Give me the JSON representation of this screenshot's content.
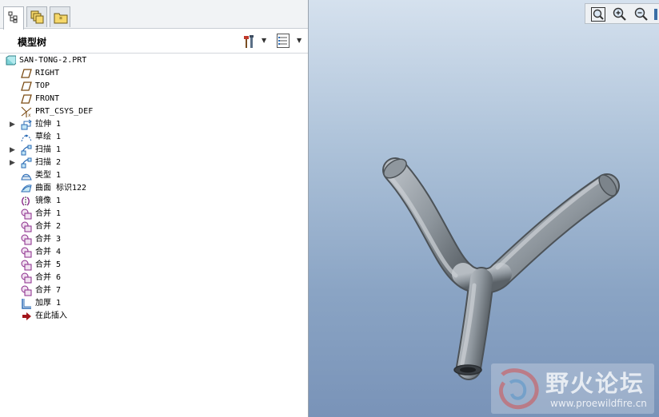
{
  "tree_panel": {
    "title": "模型树",
    "tabs": [
      {
        "icon": "model-tree-icon",
        "active": true
      },
      {
        "icon": "layers-icon",
        "active": false
      },
      {
        "icon": "favorites-folder-icon",
        "active": false
      }
    ],
    "toolbar": {
      "settings_icon": "tools-icon",
      "show_icon": "show-list-icon"
    },
    "items": [
      {
        "label": "SAN-TONG-2.PRT",
        "icon": "part-icon",
        "expandable": false
      },
      {
        "label": "RIGHT",
        "icon": "datum-plane-icon",
        "expandable": false
      },
      {
        "label": "TOP",
        "icon": "datum-plane-icon",
        "expandable": false
      },
      {
        "label": "FRONT",
        "icon": "datum-plane-icon",
        "expandable": false
      },
      {
        "label": "PRT_CSYS_DEF",
        "icon": "coordinate-system-icon",
        "expandable": false
      },
      {
        "label": "拉伸 1",
        "icon": "extrude-icon",
        "expandable": true
      },
      {
        "label": "草绘 1",
        "icon": "sketch-icon",
        "expandable": false
      },
      {
        "label": "扫描 1",
        "icon": "sweep-icon",
        "expandable": true
      },
      {
        "label": "扫描 2",
        "icon": "sweep-icon",
        "expandable": true
      },
      {
        "label": "类型 1",
        "icon": "style-icon",
        "expandable": false
      },
      {
        "label": "曲面 标识122",
        "icon": "surface-icon",
        "expandable": false
      },
      {
        "label": "镜像 1",
        "icon": "mirror-icon",
        "expandable": false
      },
      {
        "label": "合并 1",
        "icon": "merge-icon",
        "expandable": false
      },
      {
        "label": "合并 2",
        "icon": "merge-icon",
        "expandable": false
      },
      {
        "label": "合并 3",
        "icon": "merge-icon",
        "expandable": false
      },
      {
        "label": "合并 4",
        "icon": "merge-icon",
        "expandable": false
      },
      {
        "label": "合并 5",
        "icon": "merge-icon",
        "expandable": false
      },
      {
        "label": "合并 6",
        "icon": "merge-icon",
        "expandable": false
      },
      {
        "label": "合并 7",
        "icon": "merge-icon",
        "expandable": false
      },
      {
        "label": "加厚 1",
        "icon": "thicken-icon",
        "expandable": false
      },
      {
        "label": "在此插入",
        "icon": "insert-here-arrow-icon",
        "expandable": false
      }
    ]
  },
  "viewport": {
    "toolbar": [
      {
        "name": "refit",
        "icon": "refit-icon"
      },
      {
        "name": "zoom-in",
        "icon": "zoom-in-icon"
      },
      {
        "name": "zoom-out",
        "icon": "zoom-out-icon"
      }
    ],
    "watermark": {
      "title": "野火论坛",
      "url": "www.proewildfire.cn"
    }
  },
  "colors": {
    "viewport_top": "#d5e1ee",
    "viewport_bottom": "#7993b8",
    "model_gray": "#8e969d",
    "insert_arrow": "#a3161b"
  }
}
